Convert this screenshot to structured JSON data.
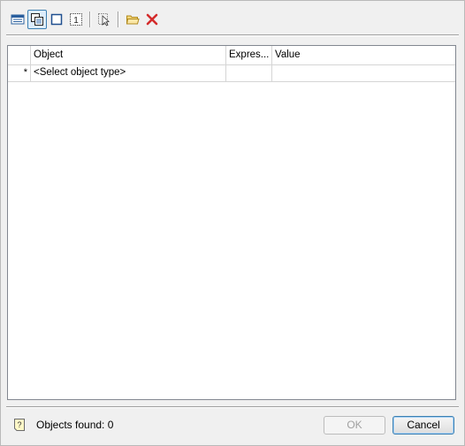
{
  "toolbar": {
    "buttons": [
      {
        "icon": "table-view-icon",
        "active": false
      },
      {
        "icon": "select-objects-icon",
        "active": true
      },
      {
        "icon": "rectangle-icon",
        "active": false
      },
      {
        "icon": "numbered-frame-icon",
        "active": false
      },
      {
        "icon": "pick-cursor-icon",
        "active": false
      },
      {
        "icon": "folder-open-icon",
        "active": false
      },
      {
        "icon": "delete-icon",
        "active": false
      }
    ]
  },
  "grid": {
    "columns": [
      "",
      "Object",
      "Expres...",
      "Value"
    ],
    "rows": [
      {
        "indicator": "*",
        "object": "<Select object type>",
        "expression": "",
        "value": ""
      }
    ]
  },
  "footer": {
    "status": "Objects found: 0",
    "ok_label": "OK",
    "cancel_label": "Cancel"
  },
  "colors": {
    "delete": "#d42b2b",
    "folder": "#e8c34a",
    "accent": "#3c7fb1"
  }
}
